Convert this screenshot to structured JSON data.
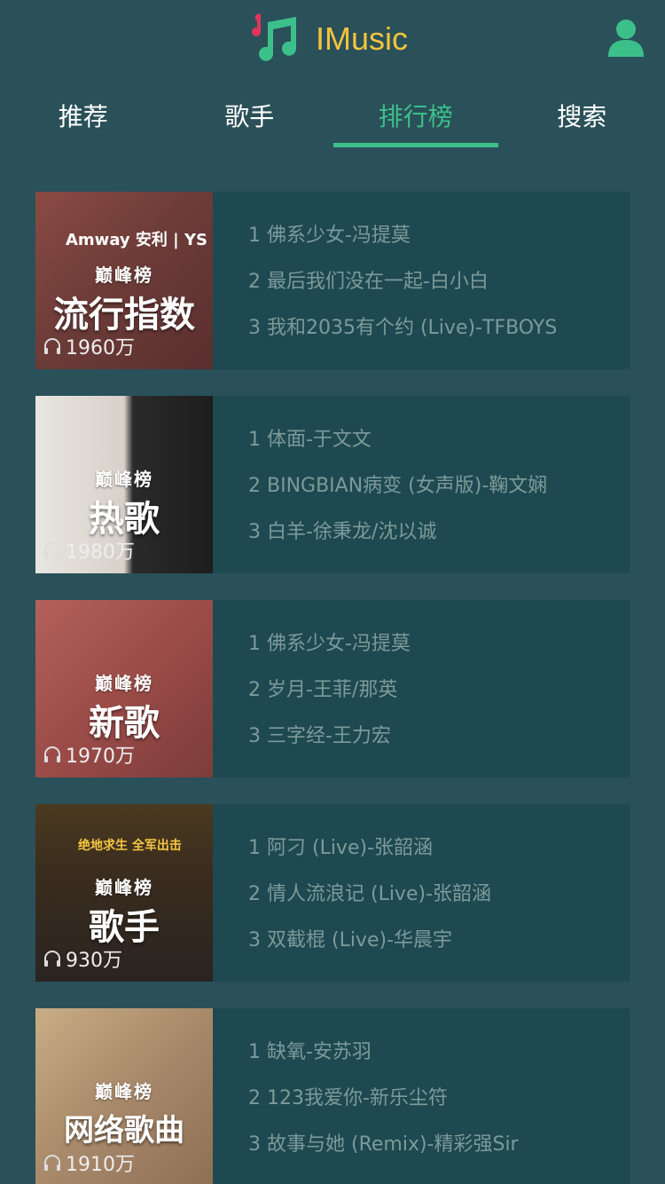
{
  "app": {
    "title": "IMusic"
  },
  "icons": {
    "logo": "music-note-icon",
    "user": "user-icon",
    "headphones": "headphones-icon"
  },
  "colors": {
    "accent": "#3cc08a",
    "brand": "#f5c33c",
    "background": "#2a5059",
    "card": "#1e4950",
    "song_text": "#7d9a9a"
  },
  "tabs": [
    {
      "label": "推荐",
      "active": false
    },
    {
      "label": "歌手",
      "active": false
    },
    {
      "label": "排行榜",
      "active": true
    },
    {
      "label": "搜索",
      "active": false
    }
  ],
  "rankings": [
    {
      "cover_peak": "巅峰榜",
      "cover_title": "流行指数",
      "cover_brand": "Amway 安利 | YS",
      "plays": "1960万",
      "songs": [
        "1 佛系少女-冯提莫",
        "2 最后我们没在一起-白小白",
        "3 我和2035有个约 (Live)-TFBOYS"
      ]
    },
    {
      "cover_peak": "巅峰榜",
      "cover_title": "热歌",
      "plays": "1980万",
      "songs": [
        "1 体面-于文文",
        "2 BINGBIAN病变 (女声版)-鞠文娴",
        "3 白羊-徐秉龙/沈以诚"
      ]
    },
    {
      "cover_peak": "巅峰榜",
      "cover_title": "新歌",
      "plays": "1970万",
      "songs": [
        "1 佛系少女-冯提莫",
        "2 岁月-王菲/那英",
        "3 三字经-王力宏"
      ]
    },
    {
      "cover_peak": "巅峰榜",
      "cover_title": "歌手",
      "cover_brand": "绝地求生 全军出击",
      "plays": "930万",
      "songs": [
        "1 阿刁 (Live)-张韶涵",
        "2 情人流浪记 (Live)-张韶涵",
        "3 双截棍 (Live)-华晨宇"
      ]
    },
    {
      "cover_peak": "巅峰榜",
      "cover_title": "网络歌曲",
      "plays": "1910万",
      "songs": [
        "1 缺氧-安苏羽",
        "2 123我爱你-新乐尘符",
        "3 故事与她 (Remix)-精彩强Sir"
      ]
    }
  ]
}
